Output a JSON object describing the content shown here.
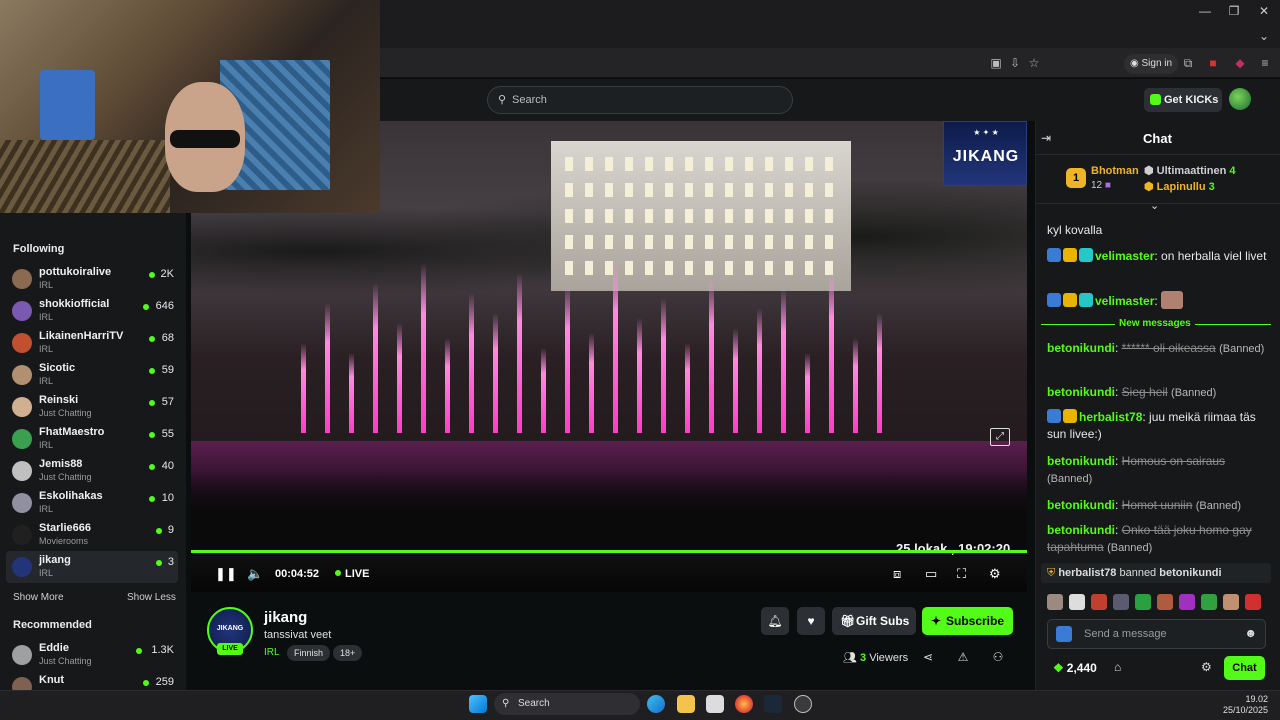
{
  "browser": {
    "sign_in_label": "Sign in"
  },
  "header": {
    "search_placeholder": "Search",
    "get_kicks_label": "Get KICKs"
  },
  "sidebar": {
    "following_title": "Following",
    "following": [
      {
        "name": "pottukoiralive",
        "category": "IRL",
        "viewers": "2K",
        "avatar_color": "#8a6a50"
      },
      {
        "name": "shokkiofficial",
        "category": "IRL",
        "viewers": "646",
        "avatar_color": "#7a5ab0"
      },
      {
        "name": "LikainenHarriTV",
        "category": "IRL",
        "viewers": "68",
        "avatar_color": "#c05030"
      },
      {
        "name": "Sicotic",
        "category": "IRL",
        "viewers": "59",
        "avatar_color": "#b09070"
      },
      {
        "name": "Reinski",
        "category": "Just Chatting",
        "viewers": "57",
        "avatar_color": "#d0b090"
      },
      {
        "name": "FhatMaestro",
        "category": "IRL",
        "viewers": "55",
        "avatar_color": "#3aa050"
      },
      {
        "name": "Jemis88",
        "category": "Just Chatting",
        "viewers": "40",
        "avatar_color": "#c0c0c0"
      },
      {
        "name": "Eskolihakas",
        "category": "IRL",
        "viewers": "10",
        "avatar_color": "#9090a0"
      },
      {
        "name": "Starlie666",
        "category": "Movierooms",
        "viewers": "9",
        "avatar_color": "#202020"
      },
      {
        "name": "jikang",
        "category": "IRL",
        "viewers": "3",
        "avatar_color": "#22357a"
      }
    ],
    "show_more": "Show More",
    "show_less": "Show Less",
    "recommended_title": "Recommended",
    "recommended": [
      {
        "name": "Eddie",
        "category": "Just Chatting",
        "viewers": "1.3K",
        "avatar_color": "#a0a0a0"
      },
      {
        "name": "Knut",
        "category": "",
        "viewers": "259",
        "avatar_color": "#806050"
      }
    ]
  },
  "player": {
    "overlay_logo": "JIKANG",
    "timestamp": "25 lokak., 19:02:20",
    "elapsed": "00:04:52",
    "live_label": "LIVE"
  },
  "stream": {
    "channel": "jikang",
    "title": "tanssivat veet",
    "category": "IRL",
    "tags": [
      "Finnish",
      "18+"
    ],
    "live_badge": "LIVE",
    "avatar_text": "JIKANG",
    "gift_label": "Gift Subs",
    "subscribe_label": "Subscribe",
    "viewer_count": "3",
    "viewer_label": "Viewers"
  },
  "chat": {
    "title": "Chat",
    "leaderboard": [
      {
        "rank": "1",
        "name": "Bhotman",
        "count": "12",
        "color": "#f0b429"
      },
      {
        "name": "Ultimaattinen",
        "count": "4",
        "color": "#cfcfcf"
      },
      {
        "name": "Lapinullu",
        "count": "3",
        "color": "#f0b429"
      }
    ],
    "messages_top": [
      {
        "user": "",
        "text": "kyl kovalla"
      },
      {
        "user": "velimaster",
        "text": "on herballa viel livet"
      },
      {
        "user": "velimaster",
        "text": ""
      }
    ],
    "new_messages_label": "New messages",
    "messages": [
      {
        "user": "betonikundi",
        "struck": "****** oli oikeassa",
        "note": "(Banned)"
      },
      {
        "user": "betonikundi",
        "struck": "Sieg heil",
        "note": "(Banned)"
      },
      {
        "user": "herbalist78",
        "text": "juu meikä riimaa täs sun livee:)"
      },
      {
        "user": "betonikundi",
        "struck": "Homous on sairaus",
        "note": "(Banned)"
      },
      {
        "user": "betonikundi",
        "struck": "Homot uuniin",
        "note": "(Banned)"
      },
      {
        "user": "betonikundi",
        "struck": "Onko tää joku homo gay tapahtuma",
        "note": "(Banned)"
      }
    ],
    "ban_notice": {
      "actor": "herbalist78",
      "action": "banned",
      "target": "betonikundi"
    },
    "input_placeholder": "Send a message",
    "points": "2,440",
    "send_label": "Chat"
  },
  "taskbar": {
    "search_label": "Search",
    "time": "19.02",
    "date": "25/10/2025"
  },
  "colors": {
    "accent": "#53fc18",
    "background": "#0b0e0f",
    "panel": "#16181a"
  }
}
